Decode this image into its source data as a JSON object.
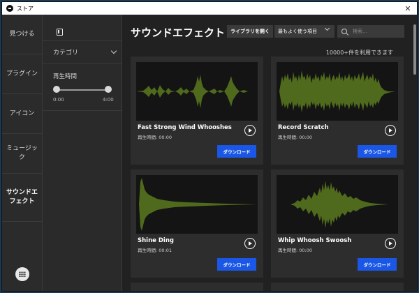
{
  "window": {
    "title": "ストア"
  },
  "nav": {
    "items": [
      {
        "label": "見つける"
      },
      {
        "label": "プラグイン"
      },
      {
        "label": "アイコン"
      },
      {
        "label": "ミュージック"
      },
      {
        "label": "サウンドエフェクト"
      }
    ]
  },
  "filters": {
    "category": "カテゴリ",
    "duration_label": "再生時間",
    "min_time": "0:00",
    "max_time": "4:00"
  },
  "main": {
    "title": "サウンドエフェクト",
    "open_library": "ライブラリを開く",
    "sort_value": "最もよく使う項目",
    "search_placeholder": "検索...",
    "count": "10000+件を利用できます"
  },
  "cards": [
    {
      "title": "Fast Strong Wind Whooshes",
      "duration": "再生時間: 00:00",
      "download": "ダウンロード"
    },
    {
      "title": "Record Scratch",
      "duration": "再生時間: 00:00",
      "download": "ダウンロード"
    },
    {
      "title": "Shine Ding",
      "duration": "再生時間: 00:01",
      "download": "ダウンロード"
    },
    {
      "title": "Whip Whoosh Swoosh",
      "duration": "再生時間: 00:00",
      "download": "ダウンロード"
    }
  ],
  "colors": {
    "accent": "#1a57e6",
    "waveform": "#4f6a1c"
  }
}
